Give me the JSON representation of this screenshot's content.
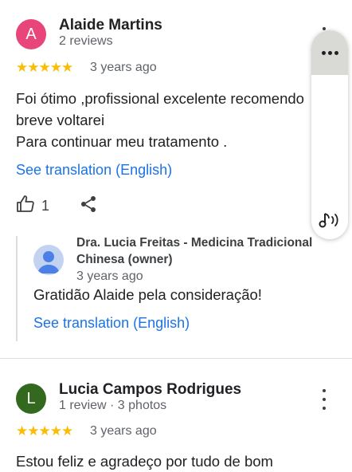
{
  "reviews": [
    {
      "initial": "A",
      "avatar_color": "#e8457a",
      "name": "Alaide Martins",
      "meta": "2 reviews",
      "stars": "★★★★★",
      "time": "3 years ago",
      "text_lines": [
        "Foi ótimo ,profissional excelente recomendo",
        "breve voltarei",
        "Para continuar meu tratamento ."
      ],
      "translation": "See translation (English)",
      "likes": "1",
      "reply": {
        "author_line1": "Dra. Lucia Freitas - Medicina Tradicional",
        "author_line2": "Chinesa (owner)",
        "time": "3 years ago",
        "text": "Gratidão Alaide pela consideração!",
        "translation": "See translation (English)"
      }
    },
    {
      "initial": "L",
      "avatar_color": "#33691e",
      "name": "Lucia Campos Rodrigues",
      "meta": "1 review · 3 photos",
      "stars": "★★★★★",
      "time": "3 years ago",
      "text_lines": [
        "Estou feliz e agradeço por tudo de bom"
      ]
    }
  ],
  "icons": {
    "more": "more-vert-icon",
    "like": "thumb-up-icon",
    "share": "share-icon",
    "side_more": "more-horiz-icon",
    "read_aloud": "read-aloud-icon",
    "owner": "person-icon"
  },
  "colors": {
    "link": "#1a73e8",
    "star": "#fbbc04"
  }
}
